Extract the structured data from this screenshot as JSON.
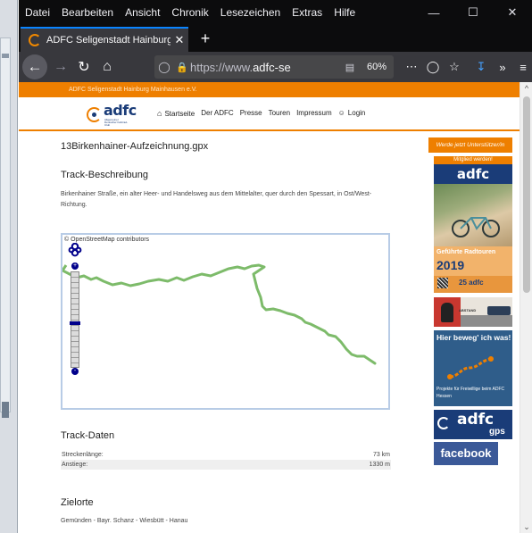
{
  "menubar": {
    "items": [
      "Datei",
      "Bearbeiten",
      "Ansicht",
      "Chronik",
      "Lesezeichen",
      "Extras",
      "Hilfe"
    ]
  },
  "tab": {
    "title": "ADFC Seligenstadt Hainburg Ma"
  },
  "navbar": {
    "url_prefix": "https://www.",
    "url_domain": "adfc-se",
    "zoom": "60%"
  },
  "site": {
    "topbar": "ADFC Seligenstadt Hainburg Mainhausen e.V.",
    "logo_word": "adfc",
    "logo_tagline": "Allgemeiner Deutscher Fahrrad-Club",
    "nav": [
      "Startseite",
      "Der ADFC",
      "Presse",
      "Touren",
      "Impressum",
      "Login"
    ]
  },
  "main": {
    "file_title": "13Birkenhainer-Aufzeichnung.gpx",
    "track_heading": "Track-Beschreibung",
    "description": "Birkenhainer Straße, ein alter Heer- und Handelsweg aus dem Mittelalter, quer durch den Spessart, in Ost/West-Richtung.",
    "map_attribution": "© OpenStreetMap contributors",
    "data_heading": "Track-Daten",
    "data_rows": [
      {
        "label": "Streckenlänge:",
        "value": "73 km"
      },
      {
        "label": "Anstiege:",
        "value": "1330 m"
      }
    ],
    "ziel_heading": "Zielorte",
    "ziel_text": "Gemünden - Bayr. Schanz - Wiesbütt - Hanau"
  },
  "sidebar": {
    "support": "Werde jetzt Unterstützer/in",
    "banner1_top": "Mitglied werden!",
    "banner1_logo": "adfc",
    "banner1_line1": "Geführte Radtouren",
    "banner1_year": "2019",
    "banner1_badge_num": "25",
    "banner1_badge_word": "adfc",
    "banner2_label": "ABSTAND",
    "banner3_title": "Hier beweg' ich was!",
    "banner3_text": "Projekte für Freiwillige beim ADFC Hessen",
    "banner4_word": "adfc",
    "banner4_gps": "gps",
    "banner5": "facebook"
  },
  "colors": {
    "accent": "#ee7f00",
    "brand_blue": "#1a3c78",
    "track_green": "#7dbb6a",
    "facebook": "#3b5998"
  }
}
